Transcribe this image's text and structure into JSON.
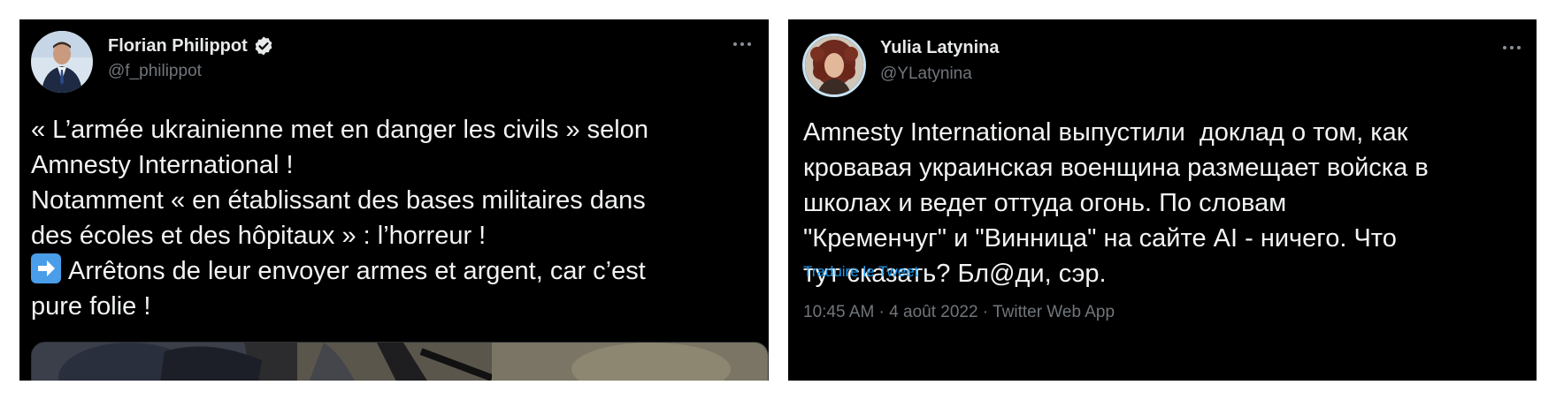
{
  "tweets": [
    {
      "name": "Florian Philippot",
      "handle": "@f_philippot",
      "verified": true,
      "avatar": "profile-photo-man-in-suit",
      "lines": [
        "« L’armée ukrainienne met en danger les civils » selon",
        "Amnesty International !",
        "Notamment « en établissant des bases militaires dans",
        "des écoles et des hôpitaux » : l’horreur !",
        "Arrêtons de leur envoyer armes et argent, car c’est",
        "pure folie !"
      ],
      "emoji": "right-arrow-emoji",
      "media": "photo-soldier-with-rifle"
    },
    {
      "name": "Yulia Latynina",
      "handle": "@YLatynina",
      "verified": false,
      "avatar": "profile-photo-woman-curly-hair",
      "lines": [
        "Amnesty International выпустили  доклад о том, как",
        "кровавая украинская военщина размещает войска в",
        "школах и ведет оттуда огонь. По словам",
        "\"Кременчуг\" и \"Винница\" на сайте AI - ничего. Что",
        "тут сказать? Бл@ди, сэр."
      ],
      "translate_label": "Traduire le Tweet",
      "meta": "10:45 AM · 4 août 2022 · Twitter Web App"
    }
  ],
  "colors": {
    "background": "#000000",
    "text": "#e7e9ea",
    "secondary": "#71767b",
    "link": "#1d9bf0",
    "verified_badge": "#e7e9ea"
  }
}
